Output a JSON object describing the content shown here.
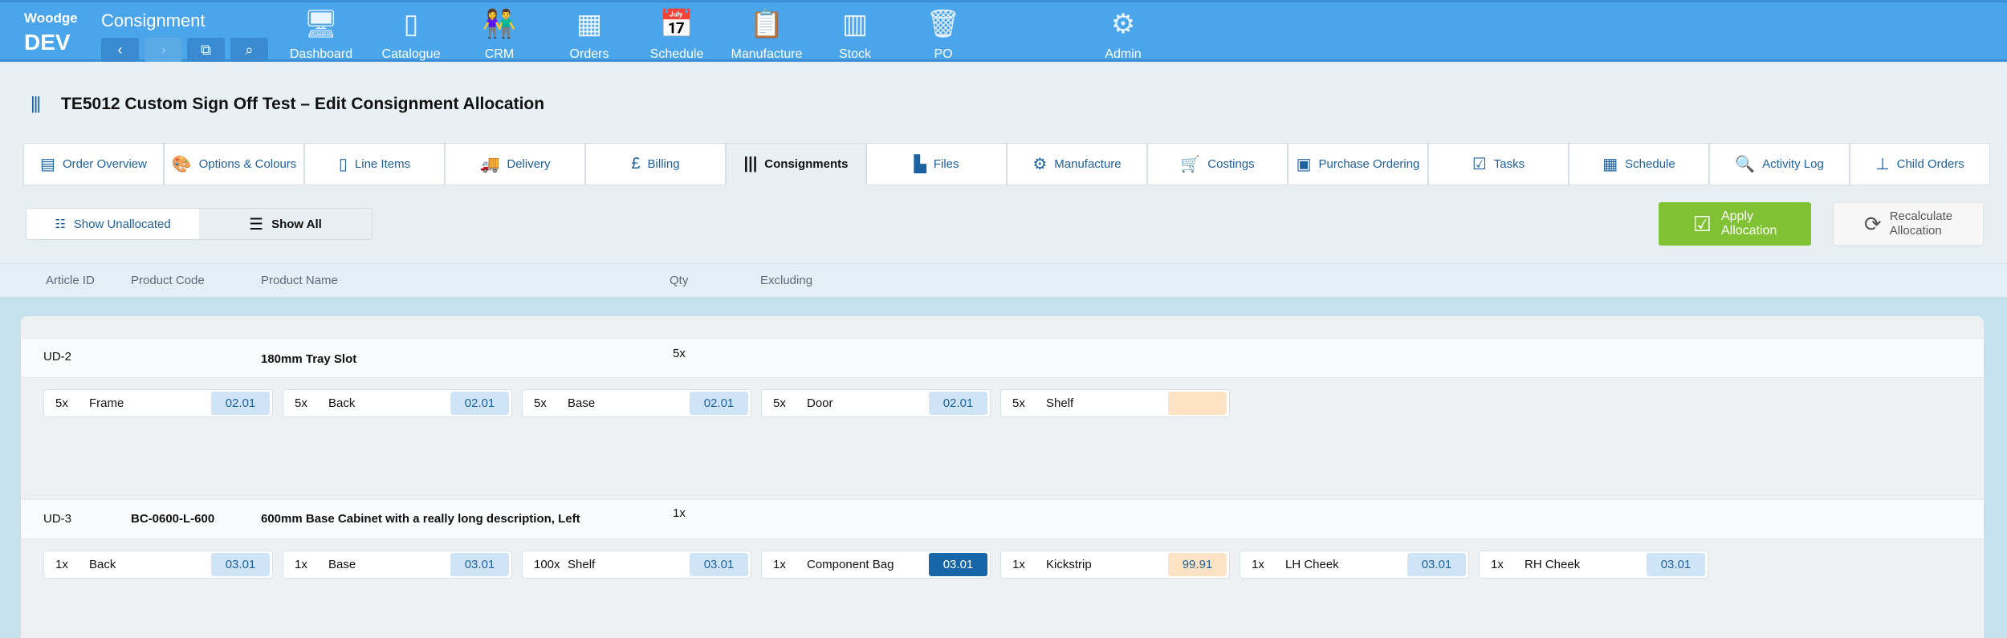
{
  "topbar": {
    "brand": "Woodge",
    "env": "DEV",
    "section": "Consignment",
    "nav": {
      "back": "‹",
      "forward": "›",
      "copy": "⧉",
      "search": "⌕"
    },
    "modules": [
      {
        "label": "Dashboard",
        "icon": "🖥"
      },
      {
        "label": "Catalogue",
        "icon": "▯"
      },
      {
        "label": "CRM",
        "icon": "👫"
      },
      {
        "label": "Orders",
        "icon": "▦"
      },
      {
        "label": "Schedule",
        "icon": "📅"
      },
      {
        "label": "Manufacture",
        "icon": "📋"
      },
      {
        "label": "Stock",
        "icon": "▥"
      },
      {
        "label": "PO",
        "icon": "🗑"
      },
      {
        "label": "Admin",
        "icon": "⚙"
      }
    ]
  },
  "page": {
    "title": "TE5012 Custom Sign Off Test – Edit Consignment Allocation",
    "icon": "|||"
  },
  "tabs": [
    {
      "label": "Order Overview",
      "icon": "▤"
    },
    {
      "label": "Options & Colours",
      "icon": "🎨"
    },
    {
      "label": "Line Items",
      "icon": "▯"
    },
    {
      "label": "Delivery",
      "icon": "🚚"
    },
    {
      "label": "Billing",
      "icon": "£"
    },
    {
      "label": "Consignments",
      "icon": "|||"
    },
    {
      "label": "Files",
      "icon": "▙"
    },
    {
      "label": "Manufacture",
      "icon": "⚙"
    },
    {
      "label": "Costings",
      "icon": "🛒"
    },
    {
      "label": "Purchase Ordering",
      "icon": "▣"
    },
    {
      "label": "Tasks",
      "icon": "☑"
    },
    {
      "label": "Schedule",
      "icon": "▦"
    },
    {
      "label": "Activity Log",
      "icon": "🔍"
    },
    {
      "label": "Child Orders",
      "icon": "⊥"
    }
  ],
  "active_tab": "Consignments",
  "toolbar": {
    "show_unallocated": "Show Unallocated",
    "show_all": "Show All",
    "apply_line1": "Apply",
    "apply_line2": "Allocation",
    "recalc_line1": "Recalculate",
    "recalc_line2": "Allocation"
  },
  "columns": {
    "article_id": "Article ID",
    "product_code": "Product Code",
    "product_name": "Product Name",
    "qty": "Qty",
    "excluding": "Excluding"
  },
  "colors": {
    "topbar": "#4ba5ea",
    "apply": "#80c233",
    "badge_light": "#cfe4f6",
    "badge_dark": "#1766a8",
    "badge_warn": "#fde3c4"
  },
  "articles": [
    {
      "id": "UD-2",
      "code": "",
      "name": "180mm Tray Slot",
      "qty": "5x",
      "parts": [
        {
          "qty": "5x",
          "name": "Frame",
          "badge": "02.01",
          "state": "light"
        },
        {
          "qty": "5x",
          "name": "Back",
          "badge": "02.01",
          "state": "light"
        },
        {
          "qty": "5x",
          "name": "Base",
          "badge": "02.01",
          "state": "light"
        },
        {
          "qty": "5x",
          "name": "Door",
          "badge": "02.01",
          "state": "light"
        },
        {
          "qty": "5x",
          "name": "Shelf",
          "badge": "",
          "state": "warn"
        }
      ]
    },
    {
      "id": "UD-3",
      "code": "BC-0600-L-600",
      "name": "600mm Base Cabinet with a really long description, Left",
      "qty": "1x",
      "parts": [
        {
          "qty": "1x",
          "name": "Back",
          "badge": "03.01",
          "state": "light"
        },
        {
          "qty": "1x",
          "name": "Base",
          "badge": "03.01",
          "state": "light"
        },
        {
          "qty": "100x",
          "name": "Shelf",
          "badge": "03.01",
          "state": "light"
        },
        {
          "qty": "1x",
          "name": "Component Bag",
          "badge": "03.01",
          "state": "dark"
        },
        {
          "qty": "1x",
          "name": "Kickstrip",
          "badge": "99.91",
          "state": "warn"
        },
        {
          "qty": "1x",
          "name": "LH Cheek",
          "badge": "03.01",
          "state": "light"
        },
        {
          "qty": "1x",
          "name": "RH Cheek",
          "badge": "03.01",
          "state": "light"
        }
      ]
    }
  ]
}
